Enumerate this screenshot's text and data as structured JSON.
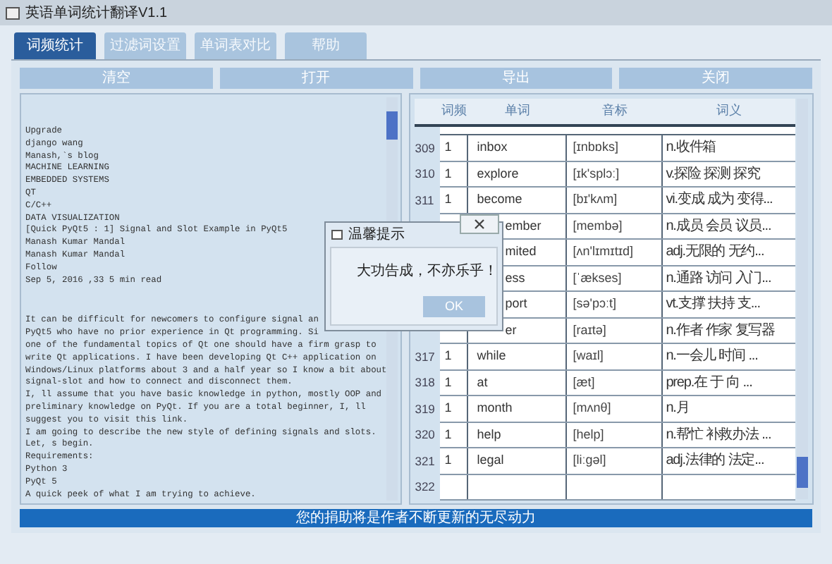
{
  "window": {
    "title": "英语单词统计翻译V1.1"
  },
  "tabs": [
    {
      "label": "词频统计",
      "selected": true
    },
    {
      "label": "过滤词设置",
      "selected": false
    },
    {
      "label": "单词表对比",
      "selected": false
    },
    {
      "label": "帮助",
      "selected": false
    }
  ],
  "toolbar": [
    "清空",
    "打开",
    "导出",
    "关闭"
  ],
  "text_area": {
    "paragraphs": [
      [
        "Upgrade",
        "django wang",
        "Manash,`s blog",
        "MACHINE LEARNING",
        "EMBEDDED SYSTEMS",
        "QT",
        "C/C++",
        "DATA VISUALIZATION",
        "[Quick PyQt5 : 1] Signal and Slot Example in PyQt5",
        "Manash Kumar Mandal",
        "Manash Kumar Mandal",
        "Follow",
        "Sep 5, 2016 ,33 5 min read"
      ],
      [
        "It can be difficult for newcomers to configure signal an",
        "PyQt5 who have no prior experience in Qt programming. Si",
        "one of the fundamental topics of Qt one should have a firm grasp to",
        "write Qt applications. I have been developing Qt C++ application on",
        "Windows/Linux platforms about 3 and a half year so I know a bit about",
        "signal-slot and how to connect and disconnect them.",
        "I, ll assume that you have basic knowledge in python, mostly OOP and",
        "preliminary knowledge on PyQt. If you are a total beginner, I, ll",
        "suggest you to visit this link.",
        "I am going to describe the new style of defining signals and slots.",
        "Let, s begin.",
        "Requirements:",
        "Python 3",
        "PyQt 5",
        "A quick peek of what I am trying to achieve."
      ]
    ]
  },
  "table": {
    "columns": [
      "词频",
      "单词",
      "音标",
      "词义"
    ],
    "rows": [
      {
        "index": "309",
        "count": "1",
        "word": "inbox",
        "phonetic": "[ɪnbɒks]",
        "meaning": "n.收件箱"
      },
      {
        "index": "310",
        "count": "1",
        "word": "explore",
        "phonetic": "[ɪk'splɔː]",
        "meaning": "v.探险 探测 探究"
      },
      {
        "index": "311",
        "count": "1",
        "word": "become",
        "phonetic": "[bɪ'kʌm]",
        "meaning": "vi.变成 成为 变得..."
      },
      {
        "word": "ember",
        "phonetic": "[membə]",
        "meaning": "n.成员 会员 议员..."
      },
      {
        "word": "mited",
        "phonetic": "[ʌn'lɪmɪtɪd]",
        "meaning": "adj.无限的 无约..."
      },
      {
        "word": "ess",
        "phonetic": "[ˈækses]",
        "meaning": "n.通路 访问 入门..."
      },
      {
        "word": "port",
        "phonetic": "[sə'pɔːt]",
        "meaning": "vt.支撑 扶持 支..."
      },
      {
        "word": "er",
        "phonetic": "[raɪtə]",
        "meaning": "n.作者 作家 复写器"
      },
      {
        "index": "317",
        "count": "1",
        "word": "while",
        "phonetic": "[waɪl]",
        "meaning": "n.一会儿 时间 ..."
      },
      {
        "index": "318",
        "count": "1",
        "word": "at",
        "phonetic": "[æt]",
        "meaning": "prep.在 于 向 ..."
      },
      {
        "index": "319",
        "count": "1",
        "word": "month",
        "phonetic": "[mʌnθ]",
        "meaning": "n.月"
      },
      {
        "index": "320",
        "count": "1",
        "word": "help",
        "phonetic": "[help]",
        "meaning": "n.帮忙 补救办法 ..."
      },
      {
        "index": "321",
        "count": "1",
        "word": "legal",
        "phonetic": "[liːgəl]",
        "meaning": "adj.法律的 法定..."
      },
      {
        "index": "322"
      }
    ]
  },
  "dialog": {
    "title": "温馨提示",
    "message": "大功告成，不亦乐乎！",
    "button": "OK"
  },
  "status_bar": "您的捐助将是作者不断更新的无尽动力"
}
